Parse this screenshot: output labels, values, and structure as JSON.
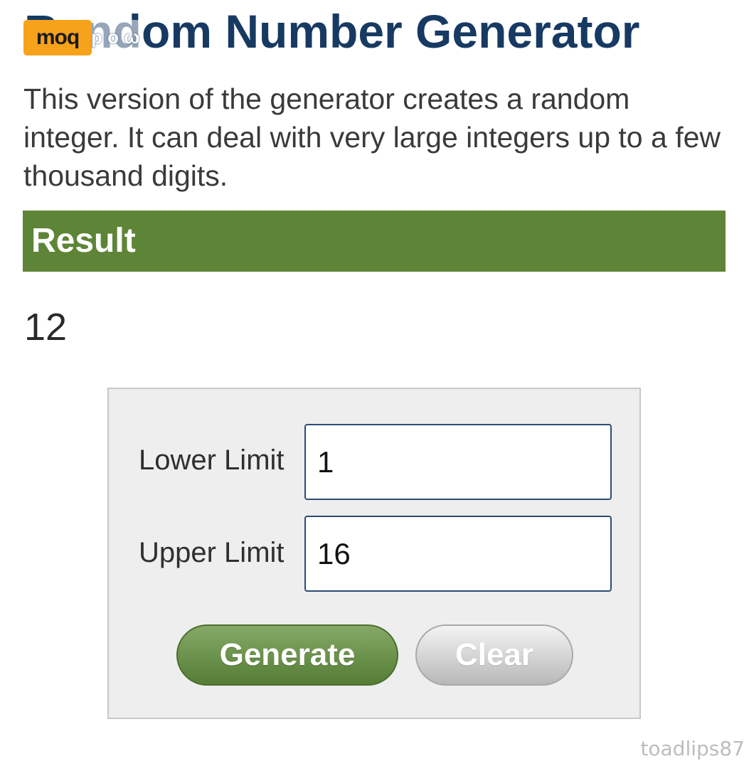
{
  "header": {
    "title": "Random Number Generator",
    "logo_text": "moq",
    "logo_overlay_text": "p o ω"
  },
  "intro": {
    "description": "This version of the generator creates a random integer. It can deal with very large integers up to a few thousand digits."
  },
  "result": {
    "heading": "Result",
    "value": "12"
  },
  "form": {
    "lower_label": "Lower Limit",
    "lower_value": "1",
    "upper_label": "Upper Limit",
    "upper_value": "16",
    "generate_label": "Generate",
    "clear_label": "Clear"
  },
  "watermark": {
    "text": "toadlips87"
  },
  "colors": {
    "title": "#173a63",
    "result_bar": "#5e8537",
    "logo_badge": "#f7a21b",
    "generate_button": "#6f9650",
    "clear_button": "#d6d6d6"
  }
}
